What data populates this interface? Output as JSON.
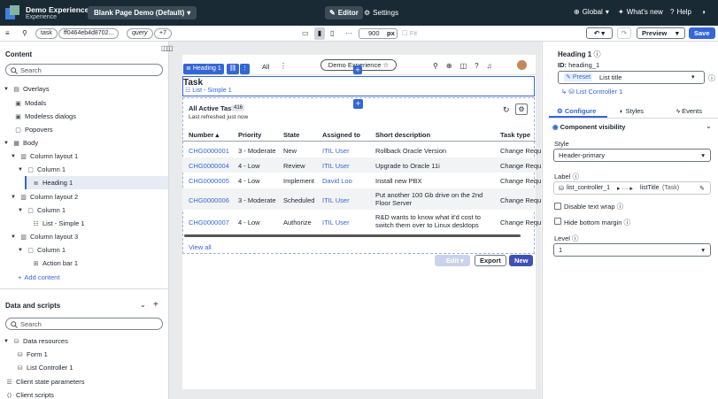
{
  "header": {
    "app_name": "Demo Experience",
    "app_sub": "Experience",
    "page": "Blank Page Demo (Default)",
    "editor": "Editor",
    "settings": "Settings",
    "scope": "Global",
    "whats_new": "What's new",
    "help": "Help"
  },
  "toolbar": {
    "chips": [
      "task",
      "ff0464eb4d8702...",
      "query",
      "+7"
    ],
    "width_value": "900",
    "width_unit": "px",
    "fit": "Fit",
    "preview": "Preview",
    "save": "Save"
  },
  "left": {
    "content_title": "Content",
    "search_placeholder": "Search",
    "tree": [
      {
        "label": "Overlays"
      },
      {
        "label": "Modals"
      },
      {
        "label": "Modeless dialogs"
      },
      {
        "label": "Popovers"
      },
      {
        "label": "Body"
      },
      {
        "label": "Column layout 1"
      },
      {
        "label": "Column 1"
      },
      {
        "label": "Heading 1"
      },
      {
        "label": "Column layout 2"
      },
      {
        "label": "Column 1"
      },
      {
        "label": "List - Simple 1"
      },
      {
        "label": "Column layout 3"
      },
      {
        "label": "Column 1"
      },
      {
        "label": "Action bar 1"
      }
    ],
    "add_content": "Add content",
    "data_title": "Data and scripts",
    "data_search": "Search",
    "data_tree": [
      {
        "label": "Data resources"
      },
      {
        "label": "Form 1"
      },
      {
        "label": "List Controller 1"
      },
      {
        "label": "Client state parameters"
      },
      {
        "label": "Client scripts"
      }
    ]
  },
  "canvas": {
    "nav_all": "All",
    "nav_pill": "Demo Experience",
    "heading_tag": "Heading 1",
    "heading_text": "Task",
    "list_tag": "List - Simple 1",
    "list_title": "All Active Tasks",
    "list_count": "416",
    "refreshed": "Last refreshed just now",
    "columns": [
      "Number",
      "Priority",
      "State",
      "Assigned to",
      "Short description",
      "Task type"
    ],
    "rows": [
      {
        "number": "CHG0000001",
        "priority": "3 - Moderate",
        "state": "New",
        "assigned": "ITIL User",
        "desc": "Rollback Oracle Version",
        "type": "Change Requ"
      },
      {
        "number": "CHG0000004",
        "priority": "4 - Low",
        "state": "Review",
        "assigned": "ITIL User",
        "desc": "Upgrade to Oracle 11i",
        "type": "Change Requ"
      },
      {
        "number": "CHG0000005",
        "priority": "4 - Low",
        "state": "Implement",
        "assigned": "David Loo",
        "desc": "Install new PBX",
        "type": "Change Requ"
      },
      {
        "number": "CHG0000006",
        "priority": "3 - Moderate",
        "state": "Scheduled",
        "assigned": "ITIL User",
        "desc": "Put another 100 Gb drive on the 2nd Floor Server",
        "type": "Change Requ"
      },
      {
        "number": "CHG0000007",
        "priority": "4 - Low",
        "state": "Authorize",
        "assigned": "ITIL User",
        "desc": "R&D wants to know what it'd cost to switch them over to Linux desktops",
        "type": "Change Requ"
      }
    ],
    "view_all": "View all",
    "edit": "Edit",
    "export": "Export",
    "new": "New"
  },
  "right": {
    "component": "Heading 1",
    "id_label": "ID:",
    "id_value": "heading_1",
    "preset_label": "Preset",
    "preset_value": "List title",
    "linked": "List Controller 1",
    "tabs": [
      "Configure",
      "Styles",
      "Events"
    ],
    "visibility": "Component visibility",
    "style_label": "Style",
    "style_value": "Header-primary",
    "label_label": "Label",
    "label_value_a": "list_controller_1",
    "label_value_b": "listTitle",
    "label_value_c": "(Task)",
    "disable_wrap": "Disable text wrap",
    "hide_margin": "Hide bottom margin",
    "level_label": "Level",
    "level_value": "1"
  },
  "colors": {
    "accent": "#3566d6",
    "topbar": "#1a2a35",
    "new_button": "#3f51b5"
  }
}
